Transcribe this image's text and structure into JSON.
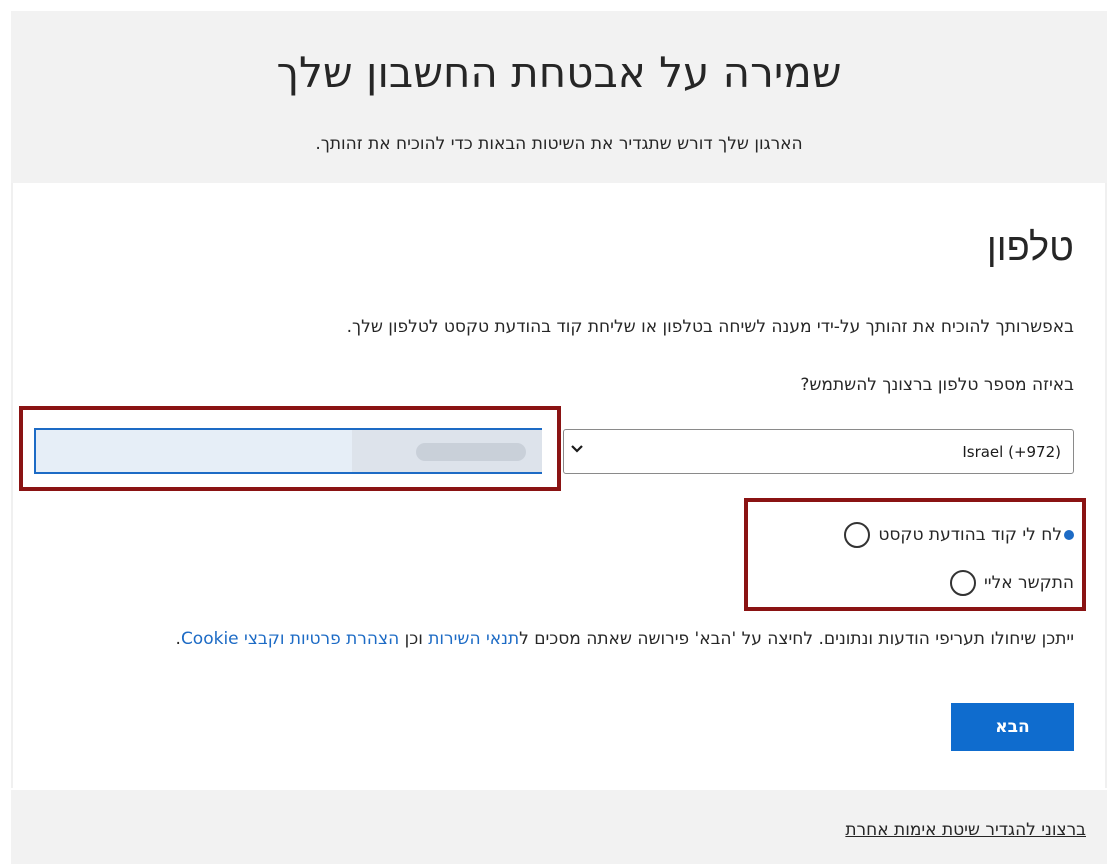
{
  "header": {
    "title": "שמירה על אבטחת החשבון שלך",
    "subtitle": "הארגון שלך דורש שתגדיר את השיטות הבאות כדי להוכיח את זהותך."
  },
  "method": {
    "title": "טלפון",
    "description": "באפשרותך להוכיח את זהותך על-ידי מענה לשיחה בטלפון או שליחת קוד בהודעת טקסט לטלפון שלך.",
    "question": "באיזה מספר טלפון ברצונך להשתמש?"
  },
  "phone": {
    "country_value": "Israel (+972)",
    "number_value": ""
  },
  "options": {
    "text_label": "לח לי קוד בהודעת טקסט",
    "call_label": "התקשר אליי"
  },
  "terms": {
    "prefix": "ייתכן שיחולו תעריפי הודעות ונתונים. לחיצה על 'הבא' פירושה שאתה מסכים ל",
    "terms_link": "תנאי השירות",
    "middle": " וכן ",
    "privacy_link": "הצהרת פרטיות וקבצי Cookie",
    "suffix": "."
  },
  "actions": {
    "next_label": "הבא",
    "alt_method_label": "ברצוני להגדיר שיטת אימות אחרת"
  },
  "colors": {
    "accent": "#0f6cce",
    "highlight_border": "#8a1313",
    "band": "#f2f2f2"
  }
}
